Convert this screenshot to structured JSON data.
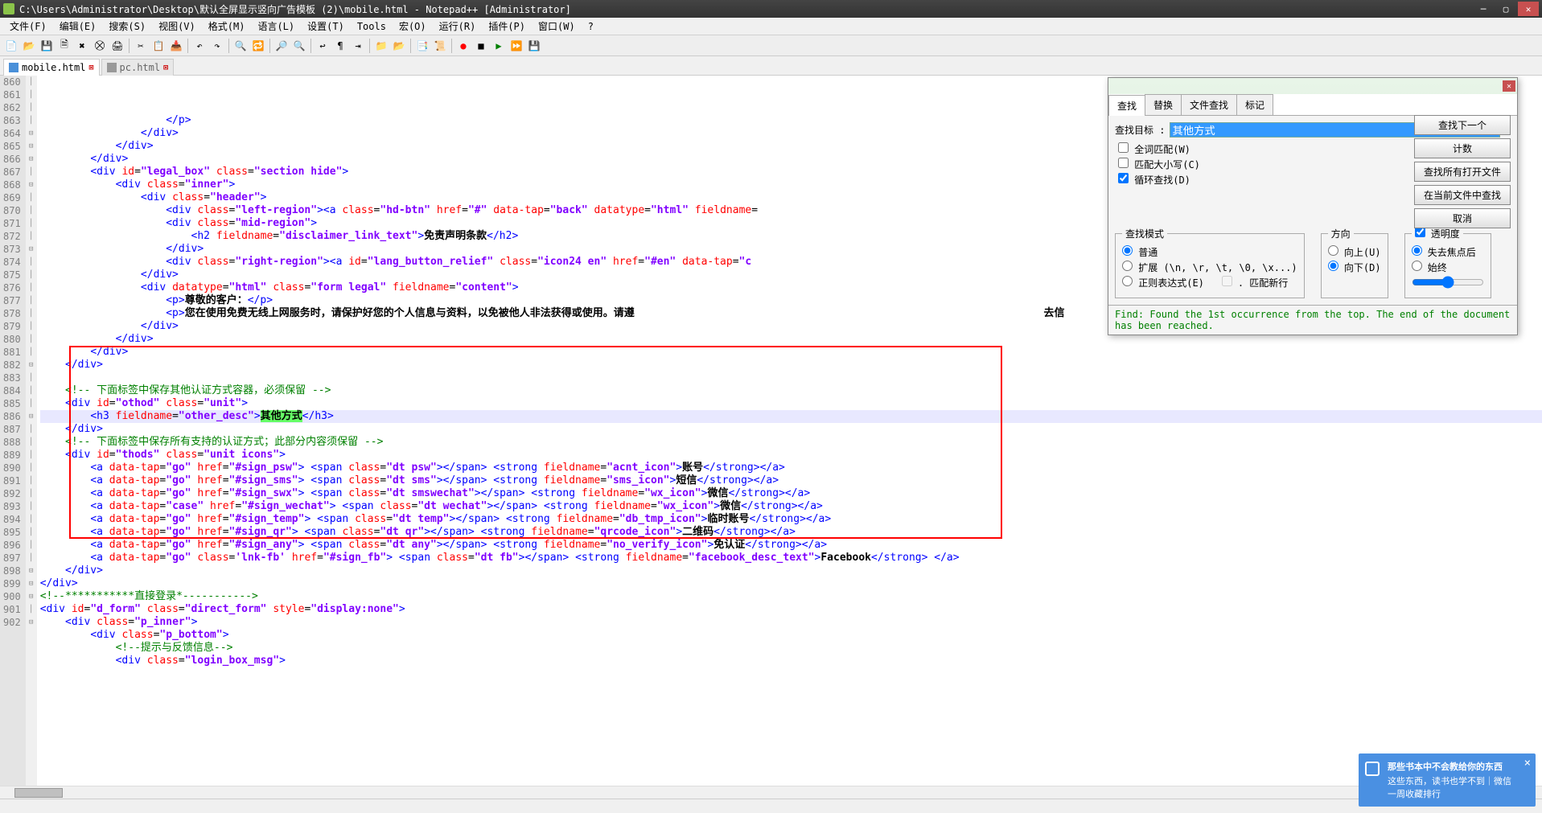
{
  "window": {
    "title": "C:\\Users\\Administrator\\Desktop\\默认全屏显示竖向广告模板 (2)\\mobile.html - Notepad++ [Administrator]"
  },
  "menu": {
    "file": "文件(F)",
    "edit": "编辑(E)",
    "search": "搜索(S)",
    "view": "视图(V)",
    "format": "格式(M)",
    "lang": "语言(L)",
    "settings": "设置(T)",
    "tools": "Tools",
    "macro": "宏(O)",
    "run": "运行(R)",
    "plugins": "插件(P)",
    "window": "窗口(W)",
    "help": "?"
  },
  "tabs": {
    "t1": "mobile.html",
    "t2": "pc.html"
  },
  "lines": {
    "start": 860,
    "end": 902,
    "rows": [
      {
        "n": 860,
        "f": "│",
        "html": "                    <span class='c-tag'>&lt;/p&gt;</span>"
      },
      {
        "n": 861,
        "f": "│",
        "html": "                <span class='c-tag'>&lt;/div&gt;</span>"
      },
      {
        "n": 862,
        "f": "│",
        "html": "            <span class='c-tag'>&lt;/div&gt;</span>"
      },
      {
        "n": 863,
        "f": "│",
        "html": "        <span class='c-tag'>&lt;/div&gt;</span>"
      },
      {
        "n": 864,
        "f": "⊟",
        "html": "        <span class='c-tag'>&lt;div</span> <span class='c-attr'>id</span>=<span class='c-val'>\"legal_box\"</span> <span class='c-attr'>class</span>=<span class='c-val'>\"section hide\"</span><span class='c-tag'>&gt;</span>"
      },
      {
        "n": 865,
        "f": "⊟",
        "html": "            <span class='c-tag'>&lt;div</span> <span class='c-attr'>class</span>=<span class='c-val'>\"inner\"</span><span class='c-tag'>&gt;</span>"
      },
      {
        "n": 866,
        "f": "⊟",
        "html": "                <span class='c-tag'>&lt;div</span> <span class='c-attr'>class</span>=<span class='c-val'>\"header\"</span><span class='c-tag'>&gt;</span>"
      },
      {
        "n": 867,
        "f": "│",
        "html": "                    <span class='c-tag'>&lt;div</span> <span class='c-attr'>class</span>=<span class='c-val'>\"left-region\"</span><span class='c-tag'>&gt;&lt;a</span> <span class='c-attr'>class</span>=<span class='c-val'>\"hd-btn\"</span> <span class='c-attr'>href</span>=<span class='c-val'>\"#\"</span> <span class='c-attr'>data-tap</span>=<span class='c-val'>\"back\"</span> <span class='c-attr'>datatype</span>=<span class='c-val'>\"html\"</span> <span class='c-attr'>fieldname</span>="
      },
      {
        "n": 868,
        "f": "⊟",
        "html": "                    <span class='c-tag'>&lt;div</span> <span class='c-attr'>class</span>=<span class='c-val'>\"mid-region\"</span><span class='c-tag'>&gt;</span>"
      },
      {
        "n": 869,
        "f": "│",
        "html": "                        <span class='c-tag'>&lt;h2</span> <span class='c-attr'>fieldname</span>=<span class='c-val'>\"disclaimer_link_text\"</span><span class='c-tag'>&gt;</span><span class='c-txt'>免责声明条款</span><span class='c-tag'>&lt;/h2&gt;</span>"
      },
      {
        "n": 870,
        "f": "│",
        "html": "                    <span class='c-tag'>&lt;/div&gt;</span>"
      },
      {
        "n": 871,
        "f": "│",
        "html": "                    <span class='c-tag'>&lt;div</span> <span class='c-attr'>class</span>=<span class='c-val'>\"right-region\"</span><span class='c-tag'>&gt;&lt;a</span> <span class='c-attr'>id</span>=<span class='c-val'>\"lang_button_relief\"</span> <span class='c-attr'>class</span>=<span class='c-val'>\"icon24 en\"</span> <span class='c-attr'>href</span>=<span class='c-val'>\"#en\"</span> <span class='c-attr'>data-tap</span>=<span class='c-val'>\"c</span>"
      },
      {
        "n": 872,
        "f": "│",
        "html": "                <span class='c-tag'>&lt;/div&gt;</span>"
      },
      {
        "n": 873,
        "f": "⊟",
        "html": "                <span class='c-tag'>&lt;div</span> <span class='c-attr'>datatype</span>=<span class='c-val'>\"html\"</span> <span class='c-attr'>class</span>=<span class='c-val'>\"form legal\"</span> <span class='c-attr'>fieldname</span>=<span class='c-val'>\"content\"</span><span class='c-tag'>&gt;</span>"
      },
      {
        "n": 874,
        "f": "│",
        "html": "                    <span class='c-tag'>&lt;p&gt;</span><span class='c-txt'>尊敬的客户：</span><span class='c-tag'>&lt;/p&gt;</span>"
      },
      {
        "n": 875,
        "f": "│",
        "html": "                    <span class='c-tag'>&lt;p&gt;</span><span class='c-txt'>您在使用免费无线上网服务时，请保护好您的个人信息与资料，以免被他人非法获得或使用。请遵</span>                                                                 <span class='c-txt'>去信</span>"
      },
      {
        "n": 876,
        "f": "│",
        "html": "                <span class='c-tag'>&lt;/div&gt;</span>"
      },
      {
        "n": 877,
        "f": "│",
        "html": "            <span class='c-tag'>&lt;/div&gt;</span>"
      },
      {
        "n": 878,
        "f": "│",
        "html": "        <span class='c-tag'>&lt;/div&gt;</span>"
      },
      {
        "n": 879,
        "f": "│",
        "html": "    <span class='c-tag'>&lt;/div&gt;</span>"
      },
      {
        "n": 880,
        "f": "│",
        "html": ""
      },
      {
        "n": 881,
        "f": "│",
        "html": "    <span class='c-cmt'>&lt;!-- 下面标签中保存其他认证方式容器，必须保留 --&gt;</span>"
      },
      {
        "n": 882,
        "f": "⊟",
        "html": "    <span class='c-tag'>&lt;div</span> <span class='c-attr'>id</span>=<span class='c-val'>\"othod\"</span> <span class='c-attr'>class</span>=<span class='c-val'>\"unit\"</span><span class='c-tag'>&gt;</span>"
      },
      {
        "n": 883,
        "f": "│",
        "hl": true,
        "html": "        <span class='c-tag'>&lt;h3</span> <span class='c-attr'>fieldname</span>=<span class='c-val'>\"other_desc\"</span><span class='c-tag'>&gt;</span><span class='c-txt' style='background:#66ff66'>其他方式</span><span class='c-tag'>&lt;/h3&gt;</span>"
      },
      {
        "n": 884,
        "f": "│",
        "html": "    <span class='c-tag'>&lt;/div&gt;</span>"
      },
      {
        "n": 885,
        "f": "│",
        "html": "    <span class='c-cmt'>&lt;!-- 下面标签中保存所有支持的认证方式；此部分内容须保留 --&gt;</span>"
      },
      {
        "n": 886,
        "f": "⊟",
        "html": "    <span class='c-tag'>&lt;div</span> <span class='c-attr'>id</span>=<span class='c-val'>\"thods\"</span> <span class='c-attr'>class</span>=<span class='c-val'>\"unit icons\"</span><span class='c-tag'>&gt;</span>"
      },
      {
        "n": 887,
        "f": "│",
        "html": "        <span class='c-tag'>&lt;a</span> <span class='c-attr'>data-tap</span>=<span class='c-val'>\"go\"</span> <span class='c-attr'>href</span>=<span class='c-val'>\"#sign_psw\"</span><span class='c-tag'>&gt;</span> <span class='c-tag'>&lt;span</span> <span class='c-attr'>class</span>=<span class='c-val'>\"dt psw\"</span><span class='c-tag'>&gt;&lt;/span&gt;</span> <span class='c-tag'>&lt;strong</span> <span class='c-attr'>fieldname</span>=<span class='c-val'>\"acnt_icon\"</span><span class='c-tag'>&gt;</span><span class='c-txt'>账号</span><span class='c-tag'>&lt;/strong&gt;&lt;/a&gt;</span>"
      },
      {
        "n": 888,
        "f": "│",
        "html": "        <span class='c-tag'>&lt;a</span> <span class='c-attr'>data-tap</span>=<span class='c-val'>\"go\"</span> <span class='c-attr'>href</span>=<span class='c-val'>\"#sign_sms\"</span><span class='c-tag'>&gt;</span> <span class='c-tag'>&lt;span</span> <span class='c-attr'>class</span>=<span class='c-val'>\"dt sms\"</span><span class='c-tag'>&gt;&lt;/span&gt;</span> <span class='c-tag'>&lt;strong</span> <span class='c-attr'>fieldname</span>=<span class='c-val'>\"sms_icon\"</span><span class='c-tag'>&gt;</span><span class='c-txt'>短信</span><span class='c-tag'>&lt;/strong&gt;&lt;/a&gt;</span>"
      },
      {
        "n": 889,
        "f": "│",
        "html": "        <span class='c-tag'>&lt;a</span> <span class='c-attr'>data-tap</span>=<span class='c-val'>\"go\"</span> <span class='c-attr'>href</span>=<span class='c-val'>\"#sign_swx\"</span><span class='c-tag'>&gt;</span> <span class='c-tag'>&lt;span</span> <span class='c-attr'>class</span>=<span class='c-val'>\"dt smswechat\"</span><span class='c-tag'>&gt;&lt;/span&gt;</span> <span class='c-tag'>&lt;strong</span> <span class='c-attr'>fieldname</span>=<span class='c-val'>\"wx_icon\"</span><span class='c-tag'>&gt;</span><span class='c-txt'>微信</span><span class='c-tag'>&lt;/strong&gt;&lt;/a&gt;</span>"
      },
      {
        "n": 890,
        "f": "│",
        "html": "        <span class='c-tag'>&lt;a</span> <span class='c-attr'>data-tap</span>=<span class='c-val'>\"case\"</span> <span class='c-attr'>href</span>=<span class='c-val'>\"#sign_wechat\"</span><span class='c-tag'>&gt;</span> <span class='c-tag'>&lt;span</span> <span class='c-attr'>class</span>=<span class='c-val'>\"dt wechat\"</span><span class='c-tag'>&gt;&lt;/span&gt;</span> <span class='c-tag'>&lt;strong</span> <span class='c-attr'>fieldname</span>=<span class='c-val'>\"wx_icon\"</span><span class='c-tag'>&gt;</span><span class='c-txt'>微信</span><span class='c-tag'>&lt;/strong&gt;&lt;/a&gt;</span>"
      },
      {
        "n": 891,
        "f": "│",
        "html": "        <span class='c-tag'>&lt;a</span> <span class='c-attr'>data-tap</span>=<span class='c-val'>\"go\"</span> <span class='c-attr'>href</span>=<span class='c-val'>\"#sign_temp\"</span><span class='c-tag'>&gt;</span> <span class='c-tag'>&lt;span</span> <span class='c-attr'>class</span>=<span class='c-val'>\"dt temp\"</span><span class='c-tag'>&gt;&lt;/span&gt;</span> <span class='c-tag'>&lt;strong</span> <span class='c-attr'>fieldname</span>=<span class='c-val'>\"db_tmp_icon\"</span><span class='c-tag'>&gt;</span><span class='c-txt'>临时账号</span><span class='c-tag'>&lt;/strong&gt;&lt;/a&gt;</span>"
      },
      {
        "n": 892,
        "f": "│",
        "html": "        <span class='c-tag'>&lt;a</span> <span class='c-attr'>data-tap</span>=<span class='c-val'>\"go\"</span> <span class='c-attr'>href</span>=<span class='c-val'>\"#sign_qr\"</span><span class='c-tag'>&gt;</span> <span class='c-tag'>&lt;span</span> <span class='c-attr'>class</span>=<span class='c-val'>\"dt qr\"</span><span class='c-tag'>&gt;&lt;/span&gt;</span> <span class='c-tag'>&lt;strong</span> <span class='c-attr'>fieldname</span>=<span class='c-val'>\"qrcode_icon\"</span><span class='c-tag'>&gt;</span><span class='c-txt'>二维码</span><span class='c-tag'>&lt;/strong&gt;&lt;/a&gt;</span>"
      },
      {
        "n": 893,
        "f": "│",
        "html": "        <span class='c-tag'>&lt;a</span> <span class='c-attr'>data-tap</span>=<span class='c-val'>\"go\"</span> <span class='c-attr'>href</span>=<span class='c-val'>\"#sign_any\"</span><span class='c-tag'>&gt;</span> <span class='c-tag'>&lt;span</span> <span class='c-attr'>class</span>=<span class='c-val'>\"dt any\"</span><span class='c-tag'>&gt;&lt;/span&gt;</span> <span class='c-tag'>&lt;strong</span> <span class='c-attr'>fieldname</span>=<span class='c-val'>\"no_verify_icon\"</span><span class='c-tag'>&gt;</span><span class='c-txt'>免认证</span><span class='c-tag'>&lt;/strong&gt;&lt;/a&gt;</span>"
      },
      {
        "n": 894,
        "f": "│",
        "html": "        <span class='c-tag'>&lt;a</span> <span class='c-attr'>data-tap</span>=<span class='c-val'>\"go\"</span> <span class='c-attr'>class</span>=<span class='c-val'>'lnk-fb'</span> <span class='c-attr'>href</span>=<span class='c-val'>\"#sign_fb\"</span><span class='c-tag'>&gt;</span> <span class='c-tag'>&lt;span</span> <span class='c-attr'>class</span>=<span class='c-val'>\"dt fb\"</span><span class='c-tag'>&gt;&lt;/span&gt;</span> <span class='c-tag'>&lt;strong</span> <span class='c-attr'>fieldname</span>=<span class='c-val'>\"facebook_desc_text\"</span><span class='c-tag'>&gt;</span><span class='c-txt'>Facebook</span><span class='c-tag'>&lt;/strong&gt;</span> <span class='c-tag'>&lt;/a&gt;</span>"
      },
      {
        "n": 895,
        "f": "│",
        "html": "    <span class='c-tag'>&lt;/div&gt;</span>"
      },
      {
        "n": 896,
        "f": "│",
        "html": "<span class='c-tag'>&lt;/div&gt;</span>"
      },
      {
        "n": 897,
        "f": "│",
        "html": "<span class='c-cmt'>&lt;!--***********直接登录*-----------&gt;</span>"
      },
      {
        "n": 898,
        "f": "⊟",
        "html": "<span class='c-tag'>&lt;div</span> <span class='c-attr'>id</span>=<span class='c-val'>\"d_form\"</span> <span class='c-attr'>class</span>=<span class='c-val'>\"direct_form\"</span> <span class='c-attr'>style</span>=<span class='c-val'>\"display:none\"</span><span class='c-tag'>&gt;</span>"
      },
      {
        "n": 899,
        "f": "⊟",
        "html": "    <span class='c-tag'>&lt;div</span> <span class='c-attr'>class</span>=<span class='c-val'>\"p_inner\"</span><span class='c-tag'>&gt;</span>"
      },
      {
        "n": 900,
        "f": "⊟",
        "html": "        <span class='c-tag'>&lt;div</span> <span class='c-attr'>class</span>=<span class='c-val'>\"p_bottom\"</span><span class='c-tag'>&gt;</span>"
      },
      {
        "n": 901,
        "f": "│",
        "html": "            <span class='c-cmt'>&lt;!--提示与反馈信息--&gt;</span>"
      },
      {
        "n": 902,
        "f": "⊟",
        "html": "            <span class='c-tag'>&lt;div</span> <span class='c-attr'>class</span>=<span class='c-val'>\"login_box_msg\"</span><span class='c-tag'>&gt;</span>"
      }
    ]
  },
  "find": {
    "tab_find": "查找",
    "tab_replace": "替换",
    "tab_infiles": "文件查找",
    "tab_mark": "标记",
    "label_target": "查找目标 :",
    "value": "其他方式",
    "btn_findnext": "查找下一个",
    "btn_count": "计数",
    "btn_findall": "查找所有打开文件",
    "btn_findcur": "在当前文件中查找",
    "btn_cancel": "取消",
    "chk_whole": "全词匹配(W)",
    "chk_case": "匹配大小写(C)",
    "chk_wrap": "循环查找(D)",
    "grp_mode": "查找模式",
    "mode_normal": "普通",
    "mode_ext": "扩展 (\\n, \\r, \\t, \\0, \\x...)",
    "mode_regex": "正则表达式(E)",
    "mode_newline": ". 匹配新行",
    "grp_dir": "方向",
    "dir_up": "向上(U)",
    "dir_down": "向下(D)",
    "grp_trans": "透明度",
    "trans_lost": "失去焦点后",
    "trans_always": "始终",
    "status": "Find: Found the 1st occurrence from the top. The end of the document has been reached."
  },
  "toast": {
    "line1": "那些书本中不会教给你的东西",
    "line2": "这些东西，读书也学不到｜微信一周收藏排行"
  }
}
